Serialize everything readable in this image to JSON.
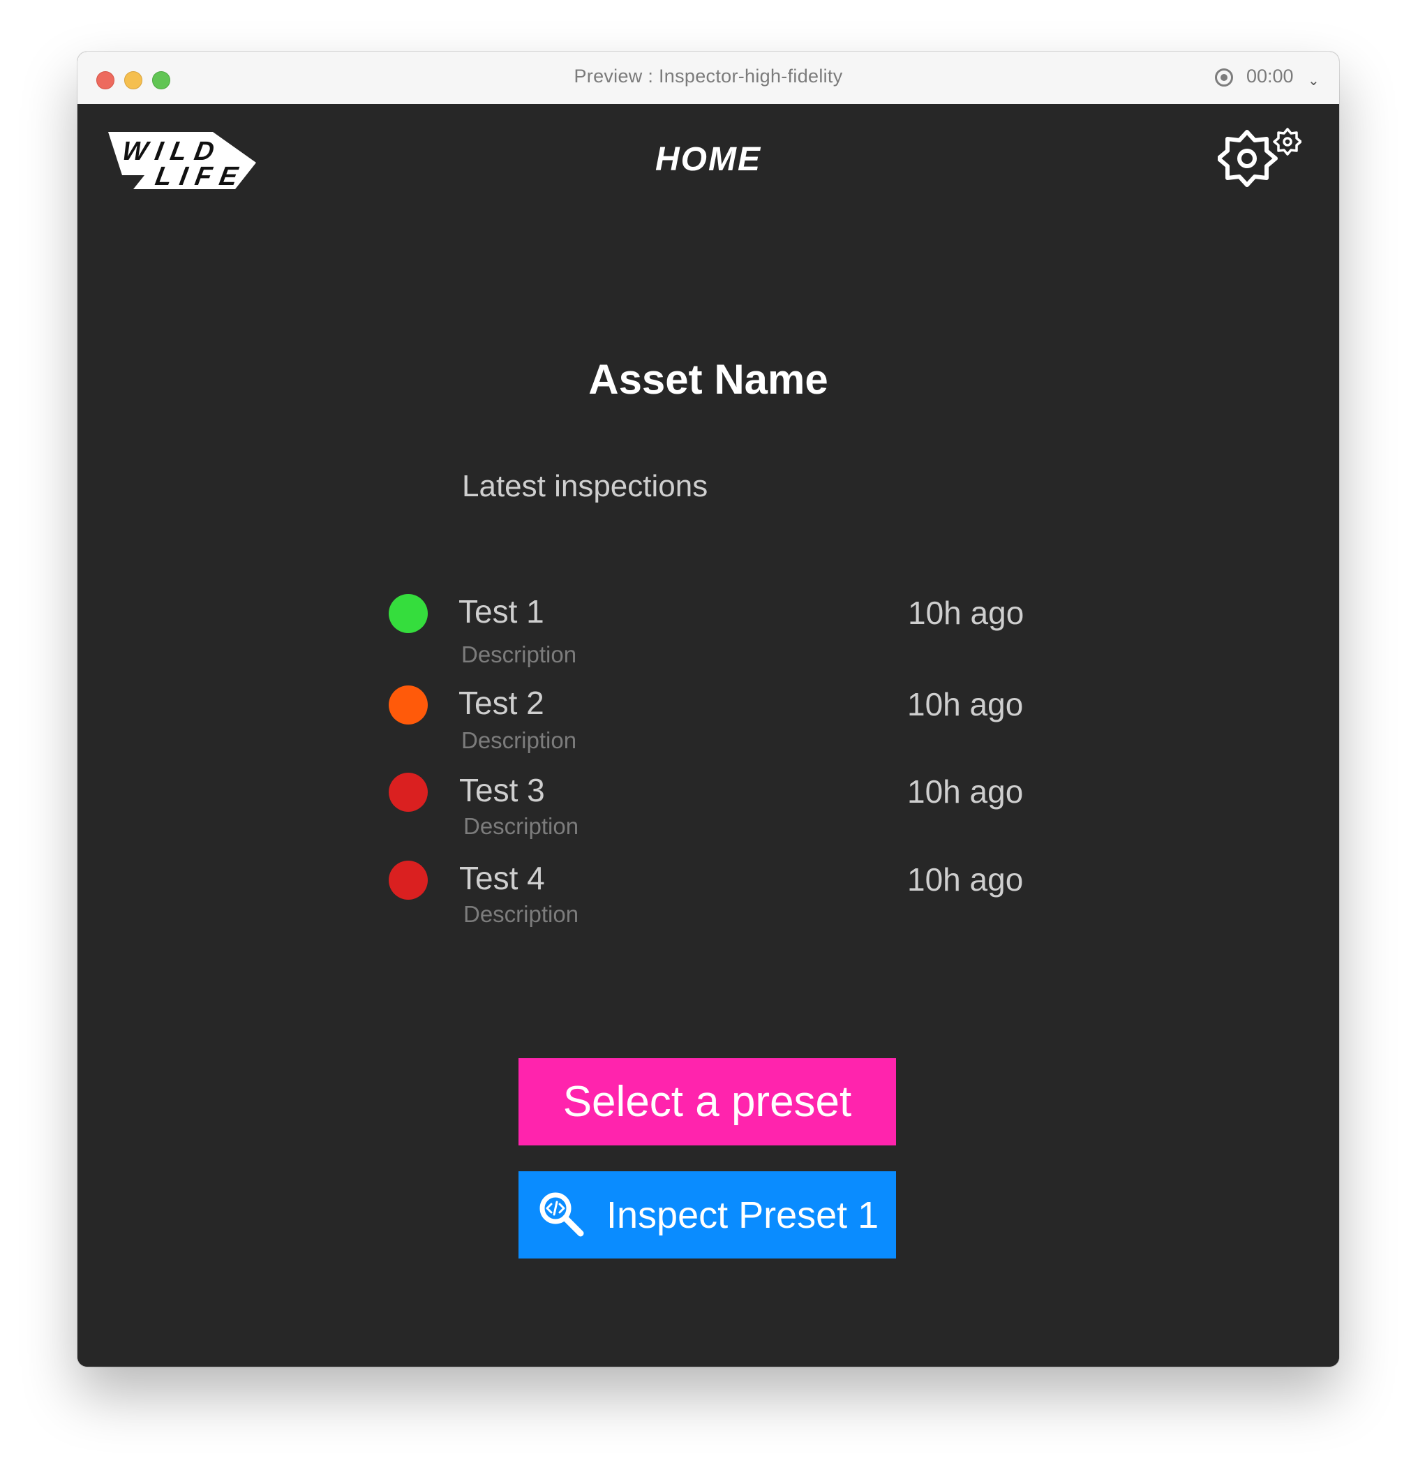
{
  "window": {
    "title": "Preview : Inspector-high-fidelity",
    "timer": "00:00"
  },
  "header": {
    "logo_text": "WILD LIFE",
    "title": "HOME"
  },
  "main": {
    "asset_name": "Asset Name",
    "section_title": "Latest inspections",
    "inspections": [
      {
        "name": "Test 1",
        "description": "Description",
        "time": "10h ago",
        "status_color": "#35dd3d"
      },
      {
        "name": "Test 2",
        "description": "Description",
        "time": "10h ago",
        "status_color": "#ff5a0a"
      },
      {
        "name": "Test 3",
        "description": "Description",
        "time": "10h ago",
        "status_color": "#da2020"
      },
      {
        "name": "Test 4",
        "description": "Description",
        "time": "10h ago",
        "status_color": "#da2020"
      }
    ],
    "select_preset_label": "Select a preset",
    "inspect_preset_label": "Inspect Preset 1"
  },
  "colors": {
    "background": "#272727",
    "select_button": "#ff24ad",
    "inspect_button": "#0a8cff"
  },
  "icons": {
    "settings": "gear-icon",
    "inspect": "search-code-icon",
    "record": "record-icon"
  }
}
